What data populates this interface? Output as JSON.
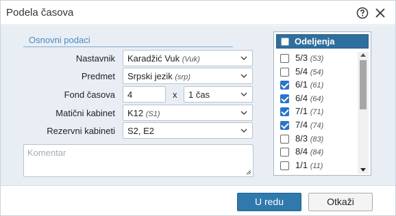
{
  "dialog": {
    "title": "Podela časova"
  },
  "form": {
    "section_title": "Osnovni podaci",
    "teacher": {
      "label": "Nastavnik",
      "value": "Karadžić Vuk",
      "code": "(Vuk)"
    },
    "subject": {
      "label": "Predmet",
      "value": "Srpski jezik",
      "code": "(srp)"
    },
    "hours": {
      "label": "Fond časova",
      "value": "4",
      "times": "x",
      "unit": "1 čas"
    },
    "main_room": {
      "label": "Matični kabinet",
      "value": "K12",
      "code": "(S1)"
    },
    "reserve_rooms": {
      "label": "Rezervni kabineti",
      "value": "S2, E2"
    },
    "comment": {
      "placeholder": "Komentar"
    }
  },
  "classes": {
    "header_label": "Odeljenja",
    "items": [
      {
        "label": "5/3",
        "code": "(53)",
        "checked": false
      },
      {
        "label": "5/4",
        "code": "(54)",
        "checked": false
      },
      {
        "label": "6/1",
        "code": "(61)",
        "checked": true
      },
      {
        "label": "6/4",
        "code": "(64)",
        "checked": true
      },
      {
        "label": "7/1",
        "code": "(71)",
        "checked": true
      },
      {
        "label": "7/4",
        "code": "(74)",
        "checked": true
      },
      {
        "label": "8/3",
        "code": "(83)",
        "checked": false
      },
      {
        "label": "8/4",
        "code": "(84)",
        "checked": false
      },
      {
        "label": "1/1",
        "code": "(11)",
        "checked": false
      }
    ]
  },
  "footer": {
    "ok_label": "U redu",
    "cancel_label": "Otkaži"
  },
  "colors": {
    "accent": "#2f79ad",
    "header_bg": "#2f6f9e",
    "panel_bg": "#e8eef4",
    "checkbox_on": "#2b73c9"
  }
}
